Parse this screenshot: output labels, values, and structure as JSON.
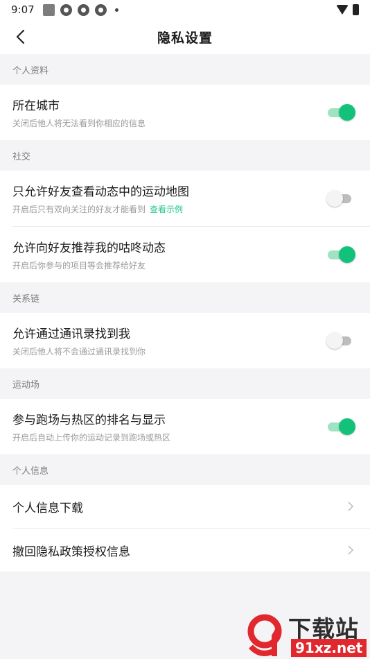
{
  "status_bar": {
    "time": "9:07"
  },
  "header": {
    "title": "隐私设置"
  },
  "sections": {
    "profile": {
      "label": "个人资料",
      "city": {
        "title": "所在城市",
        "desc": "关闭后他人将无法看到你相应的信息",
        "enabled": true
      }
    },
    "social": {
      "label": "社交",
      "friends_map": {
        "title": "只允许好友查看动态中的运动地图",
        "desc": "开启后只有双向关注的好友才能看到",
        "link": "查看示例",
        "enabled": false
      },
      "recommend": {
        "title": "允许向好友推荐我的咕咚动态",
        "desc": "开启后你参与的项目等会推荐给好友",
        "enabled": true
      }
    },
    "relations": {
      "label": "关系链",
      "contacts": {
        "title": "允许通过通讯录找到我",
        "desc": "关闭后他人将不会通过通讯录找到你",
        "enabled": false
      }
    },
    "sports": {
      "label": "运动场",
      "ranking": {
        "title": "参与跑场与热区的排名与显示",
        "desc": "开启后自动上传你的运动记录到跑场或热区",
        "enabled": true
      }
    },
    "personal_info": {
      "label": "个人信息",
      "download": {
        "title": "个人信息下载"
      },
      "revoke": {
        "title": "撤回隐私政策授权信息"
      }
    }
  },
  "colors": {
    "accent": "#13c27a",
    "link": "#24c789",
    "background": "#f4f4f6"
  },
  "watermark": {
    "text": "下载站",
    "url_text": "91xz.net"
  }
}
